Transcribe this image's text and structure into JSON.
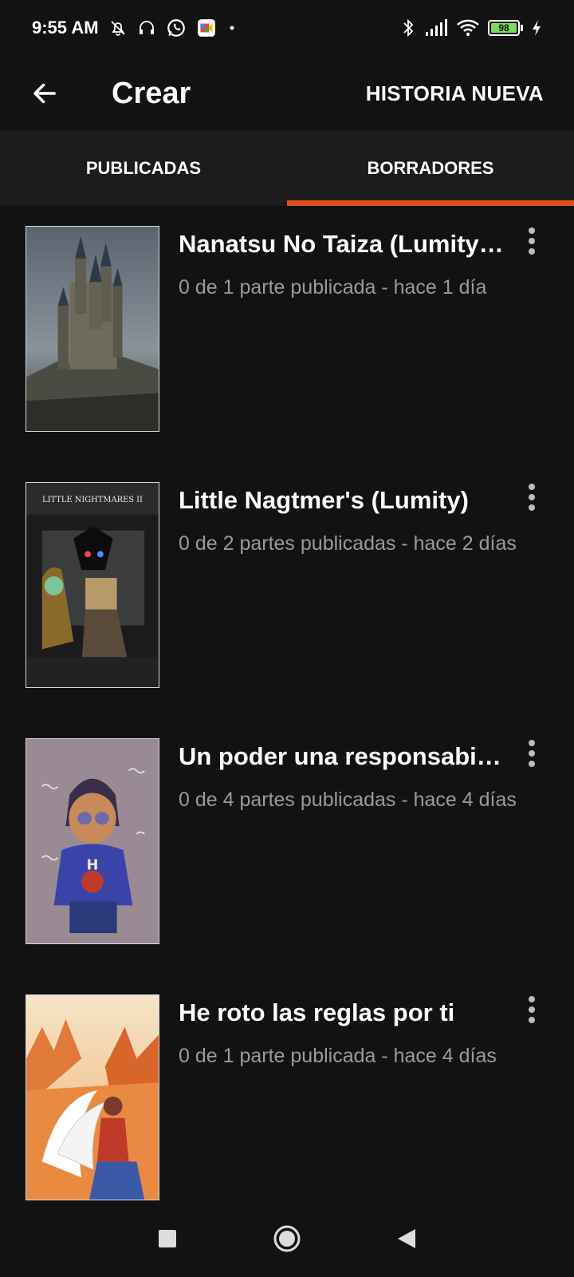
{
  "status_bar": {
    "time": "9:55 AM",
    "battery_level": "98",
    "icons": [
      "mute-bell-icon",
      "headset-icon",
      "whatsapp-icon",
      "meet-icon",
      "dot-icon",
      "bluetooth-icon",
      "signal-icon",
      "wifi-icon",
      "battery-icon",
      "charging-icon"
    ]
  },
  "app_bar": {
    "title": "Crear",
    "action_label": "HISTORIA NUEVA"
  },
  "tabs": [
    {
      "label": "PUBLICADAS",
      "selected": false
    },
    {
      "label": "BORRADORES",
      "selected": true
    }
  ],
  "colors": {
    "accent": "#e0501f",
    "background": "#121212",
    "tab_bar": "#1c1c1c",
    "meta_text": "#9a9a9a"
  },
  "stories": [
    {
      "title": "Nanatsu No Taiza (Lumity ...",
      "meta": "0 de 1 parte publicada - hace 1 día",
      "cover": "castle-cover-image"
    },
    {
      "title": "Little Nagtmer's (Lumity)",
      "meta": "0 de 2 partes publicadas - hace 2 días",
      "cover": "little-nightmares-cover-image",
      "cover_text": "LITTLE NIGHTMARES II"
    },
    {
      "title": "Un poder una responsabilid...",
      "meta": "0 de 4 partes publicadas - hace 4 días",
      "cover": "character-cover-image"
    },
    {
      "title": "He roto las reglas por ti",
      "meta": "0 de 1 parte publicada - hace 4 días",
      "cover": "autumn-angel-cover-image"
    }
  ],
  "nav_bar": {
    "icons": [
      "recents-square-icon",
      "home-circle-icon",
      "back-triangle-icon"
    ]
  }
}
